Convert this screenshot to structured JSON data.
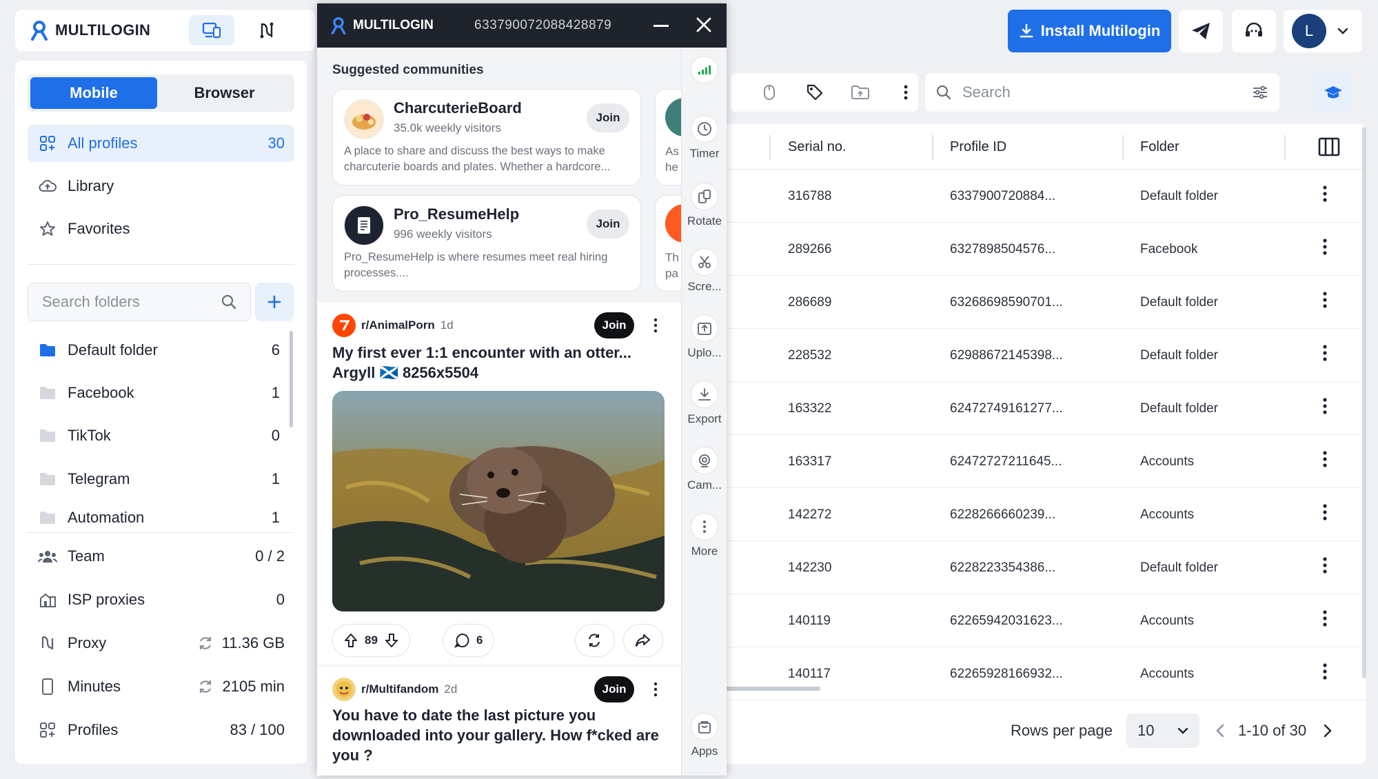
{
  "app": {
    "brand": "MULTILOGIN",
    "install_label": "Install Multilogin",
    "user_initial": "L"
  },
  "colors": {
    "accent": "#1f6fe8",
    "dark": "#1f232b",
    "text": "#1d2330"
  },
  "sidebar": {
    "tab_mobile": "Mobile",
    "tab_browser": "Browser",
    "all_profiles": {
      "label": "All profiles",
      "count": "30"
    },
    "library": "Library",
    "favorites": "Favorites",
    "search_placeholder": "Search folders",
    "folders": [
      {
        "name": "Default folder",
        "count": "6"
      },
      {
        "name": "Facebook",
        "count": "1"
      },
      {
        "name": "TikTok",
        "count": "0"
      },
      {
        "name": "Telegram",
        "count": "1"
      },
      {
        "name": "Automation",
        "count": "1"
      }
    ],
    "stats": [
      {
        "label": "Team",
        "value": "0 / 2"
      },
      {
        "label": "ISP proxies",
        "value": "0"
      },
      {
        "label": "Proxy",
        "value": "11.36 GB"
      },
      {
        "label": "Minutes",
        "value": "2105 min"
      },
      {
        "label": "Profiles",
        "value": "83 / 100"
      }
    ]
  },
  "main": {
    "search_placeholder": "Search",
    "columns": {
      "serial": "Serial no.",
      "profile_id": "Profile ID",
      "folder": "Folder"
    },
    "rows": [
      {
        "serial": "316788",
        "profile_id": "6337900720884...",
        "folder": "Default folder"
      },
      {
        "serial": "289266",
        "profile_id": "6327898504576...",
        "folder": "Facebook"
      },
      {
        "serial": "286689",
        "profile_id": "63268698590701...",
        "folder": "Default folder"
      },
      {
        "serial": "228532",
        "profile_id": "62988672145398...",
        "folder": "Default folder"
      },
      {
        "serial": "163322",
        "profile_id": "62472749161277...",
        "folder": "Default folder"
      },
      {
        "serial": "163317",
        "profile_id": "62472727211645...",
        "folder": "Accounts"
      },
      {
        "serial": "142272",
        "profile_id": "6228266660239...",
        "folder": "Accounts"
      },
      {
        "serial": "142230",
        "profile_id": "6228223354386...",
        "folder": "Default folder"
      },
      {
        "serial": "140119",
        "profile_id": "62265942031623...",
        "folder": "Accounts"
      },
      {
        "serial": "140117",
        "profile_id": "62265928166932...",
        "folder": "Accounts"
      }
    ],
    "pager": {
      "rows_per_page_label": "Rows per page",
      "rows_per_page": "10",
      "range": "1-10 of 30"
    }
  },
  "popup": {
    "brand": "MULTILOGIN",
    "profile_id": "633790072088428879",
    "suggested_title": "Suggested communities",
    "communities": [
      {
        "name": "CharcuterieBoard",
        "visitors": "35.0k weekly visitors",
        "join": "Join",
        "desc": "A place to share and discuss the best ways to make charcuterie boards and plates.  Whether a hardcore..."
      },
      {
        "name": "Pro_ResumeHelp",
        "visitors": "996 weekly visitors",
        "join": "Join",
        "desc": "Pro_ResumeHelp is where resumes meet real hiring processes...."
      }
    ],
    "peek_cards": [
      {
        "line1": "As",
        "line2": "he"
      },
      {
        "line1": "Th",
        "line2": "pa"
      }
    ],
    "posts": [
      {
        "subreddit": "r/AnimalPorn",
        "age": "1d",
        "join": "Join",
        "title_line1": "My first ever 1:1 encounter with an otter...",
        "title_line2": "Argyll 🏴󠁧󠁢󠁳󠁣󠁴󠁿 8256x5504",
        "upvotes": "89",
        "comments": "6"
      },
      {
        "subreddit": "r/Multifandom",
        "age": "2d",
        "join": "Join",
        "title": "You have to date the last picture you downloaded into your gallery. How f*cked are you ?"
      }
    ],
    "rail": [
      {
        "label": "",
        "icon": "signal-icon"
      },
      {
        "label": "Timer",
        "icon": "clock-icon"
      },
      {
        "label": "Rotate",
        "icon": "rotate-icon"
      },
      {
        "label": "Scre...",
        "icon": "screenshot-icon"
      },
      {
        "label": "Uplo...",
        "icon": "upload-icon"
      },
      {
        "label": "Export",
        "icon": "download-icon"
      },
      {
        "label": "Cam...",
        "icon": "camera-icon"
      },
      {
        "label": "More",
        "icon": "more-icon"
      },
      {
        "label": "Apps",
        "icon": "bag-icon"
      }
    ]
  }
}
